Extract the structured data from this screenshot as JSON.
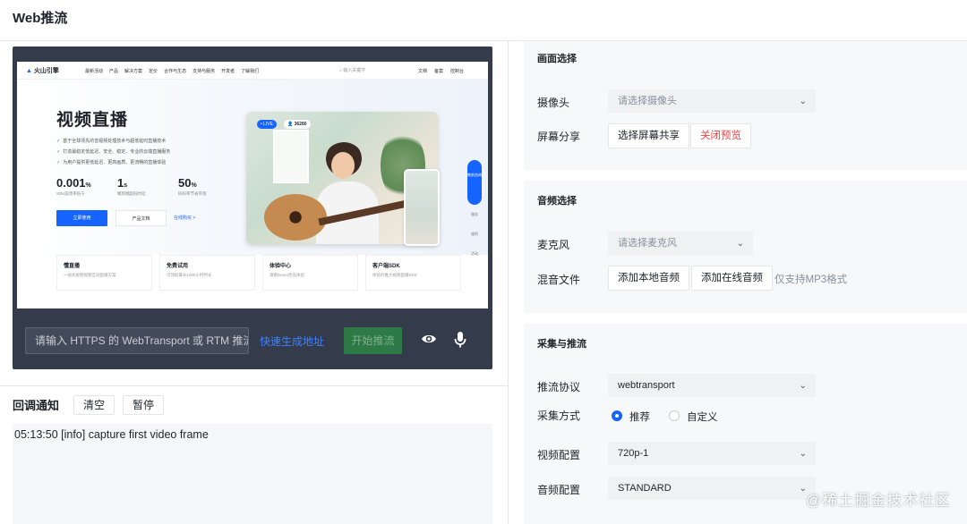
{
  "header": {
    "title": "Web推流"
  },
  "preview": {
    "nav": {
      "logo": "火山引擎",
      "links": [
        "最新活动",
        "产品",
        "解决方案",
        "定价",
        "合作与生态",
        "支持与服务",
        "开发者",
        "了解我们"
      ],
      "search_placeholder": "输入关键字",
      "right": [
        "文档",
        "备案",
        "控制台"
      ]
    },
    "hero": {
      "title": "视频直播",
      "bullets": [
        "基于全球领先的音视频处理技术与超低延时直播技术",
        "打造最稳定低延迟、安全、稳定、专业的云端直播服务",
        "为用户提供更低延迟、更高画质、更流畅的直播体验"
      ],
      "stats": [
        {
          "value": "0.001",
          "unit": "%",
          "desc": "SDK崩溃率低于"
        },
        {
          "value": "1",
          "unit": "s",
          "desc": "端到端超低时延"
        },
        {
          "value": "50",
          "unit": "%",
          "desc": "码码率节省带宽"
        }
      ],
      "btn_primary": "立即使用",
      "btn_secondary": "产品文档",
      "btn_link": "在线购买 >",
      "live_badge": "• LIVE",
      "viewer_count": "36280",
      "side_labels": [
        "售前咨询",
        "服务",
        "福利",
        "活动"
      ]
    },
    "cards": [
      {
        "title": "懂直播",
        "desc": "一站式视频视频互动直播方案"
      },
      {
        "title": "免费试用",
        "desc": "可领取最长1000小时时长"
      },
      {
        "title": "体验中心",
        "desc": "请看Demo抢先体验"
      },
      {
        "title": "客户端SDK",
        "desc": "体验的推大视频直播SDK"
      }
    ],
    "url_placeholder": "请输入 HTTPS 的 WebTransport 或 RTM 推流地址",
    "gen_link": "快速生成地址",
    "start_button": "开始推流"
  },
  "callback": {
    "title": "回调通知",
    "clear_label": "清空",
    "pause_label": "暂停",
    "log": [
      "05:13:50 [info] capture first video frame"
    ]
  },
  "settings": {
    "picture": {
      "title": "画面选择",
      "camera_label": "摄像头",
      "camera_placeholder": "请选择摄像头",
      "screen_label": "屏幕分享",
      "screen_button": "选择屏幕共享",
      "close_preview_button": "关闭预览"
    },
    "audio": {
      "title": "音频选择",
      "mic_label": "麦克风",
      "mic_placeholder": "请选择麦克风",
      "mix_label": "混音文件",
      "local_button": "添加本地音频",
      "online_button": "添加在线音频",
      "hint": "仅支持MP3格式"
    },
    "capture": {
      "title": "采集与推流",
      "protocol_label": "推流协议",
      "protocol_value": "webtransport",
      "mode_label": "采集方式",
      "mode_options": [
        "推荐",
        "自定义"
      ],
      "mode_selected": "推荐",
      "video_label": "视频配置",
      "video_value": "720p-1",
      "audio_label": "音频配置",
      "audio_value": "STANDARD"
    }
  },
  "watermark": "@稀土掘金技术社区",
  "colors": {
    "accent": "#1664ff",
    "danger": "#f53f3f",
    "start_button": "#2d7a47",
    "preview_bg": "#343c4c"
  }
}
